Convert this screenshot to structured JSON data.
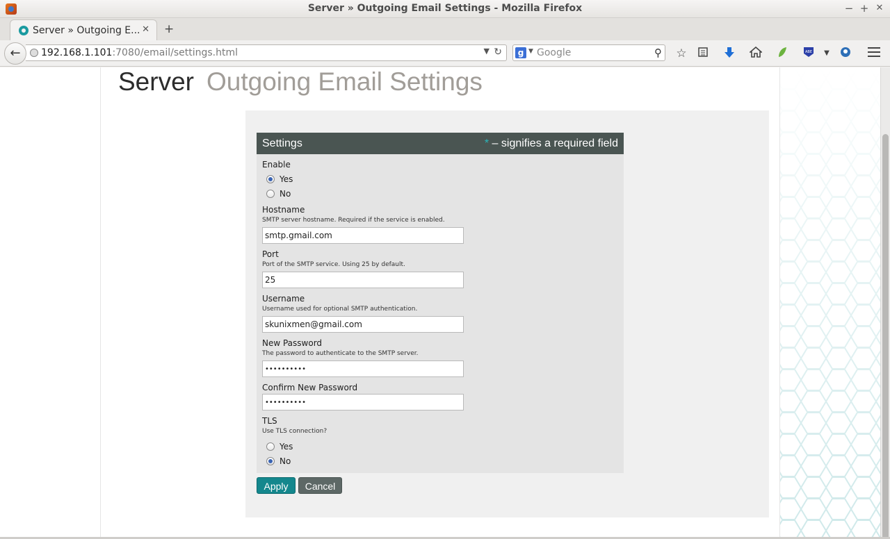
{
  "window": {
    "title": "Server » Outgoing Email Settings - Mozilla Firefox",
    "minimize": "−",
    "maximize": "+",
    "close": "✕"
  },
  "tab": {
    "label": "Server » Outgoing E...",
    "close": "✕",
    "new_tab": "+"
  },
  "navbar": {
    "url_host": "192.168.1.101",
    "url_rest": ":7080/email/settings.html",
    "search_placeholder": "Google",
    "search_engine_letter": "g"
  },
  "page": {
    "crumb_section": "Server",
    "crumb_page": "Outgoing Email Settings",
    "settings_title": "Settings",
    "required_star": "*",
    "required_note": " – signifies a required field",
    "enable": {
      "label": "Enable",
      "options": [
        "Yes",
        "No"
      ],
      "selected": "Yes"
    },
    "hostname": {
      "label": "Hostname",
      "hint": "SMTP server hostname. Required if the service is enabled.",
      "value": "smtp.gmail.com"
    },
    "port": {
      "label": "Port",
      "hint": "Port of the SMTP service. Using 25 by default.",
      "value": "25"
    },
    "username": {
      "label": "Username",
      "hint": "Username used for optional SMTP authentication.",
      "value": "skunixmen@gmail.com"
    },
    "new_password": {
      "label": "New Password",
      "hint": "The password to authenticate to the SMTP server.",
      "value": "••••••••••"
    },
    "confirm_password": {
      "label": "Confirm New Password",
      "value": "••••••••••"
    },
    "tls": {
      "label": "TLS",
      "hint": "Use TLS connection?",
      "options": [
        "Yes",
        "No"
      ],
      "selected": "No"
    },
    "apply_label": "Apply",
    "cancel_label": "Cancel"
  },
  "colors": {
    "header_bg": "#4a5552",
    "accent": "#14878d",
    "required_star": "#2ab5b9"
  },
  "icons": [
    "firefox-logo-icon",
    "tab-favicon-icon",
    "back-arrow-icon",
    "globe-icon",
    "reload-icon",
    "search-icon",
    "star-bookmark-icon",
    "reading-list-icon",
    "download-icon",
    "home-icon",
    "leaf-addon-icon",
    "abe-addon-icon",
    "profile-addon-icon",
    "hamburger-menu-icon"
  ]
}
